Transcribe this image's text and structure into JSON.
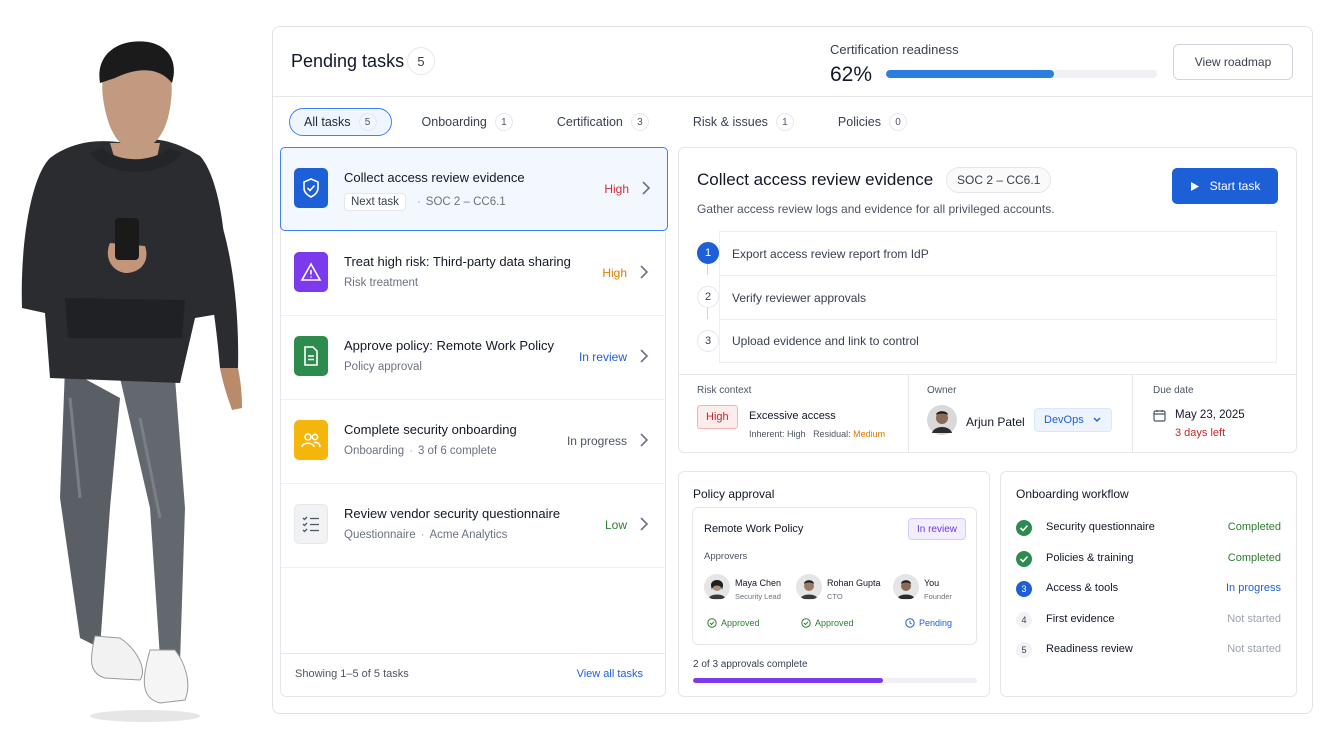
{
  "header": {
    "title": "Pending tasks",
    "count": "5",
    "readiness_label": "Certification readiness",
    "readiness_pct": "62%",
    "readiness_value": 0.62,
    "roadmap_label": "View roadmap"
  },
  "tabs": [
    {
      "label": "All tasks",
      "count": "5"
    },
    {
      "label": "Onboarding",
      "count": "1"
    },
    {
      "label": "Certification",
      "count": "3"
    },
    {
      "label": "Risk & issues",
      "count": "1"
    },
    {
      "label": "Policies",
      "count": "0"
    }
  ],
  "tasks": [
    {
      "name": "Collect access review evidence",
      "chip": "Next task",
      "sub": "SOC 2 – CC6.1",
      "status": "High",
      "icon": "shield-icon"
    },
    {
      "name": "Treat high risk: Third-party data sharing",
      "sub": "Risk treatment",
      "status": "High",
      "icon": "warning-icon"
    },
    {
      "name": "Approve policy: Remote Work Policy",
      "sub": "Policy approval",
      "status": "In review",
      "icon": "document-icon"
    },
    {
      "name": "Complete security onboarding",
      "sub": "Onboarding",
      "sub2": "3 of 6 complete",
      "status": "In progress",
      "icon": "users-icon"
    },
    {
      "name": "Review vendor security questionnaire",
      "sub": "Questionnaire",
      "sub2": "Acme Analytics",
      "status": "Low",
      "icon": "checklist-icon"
    }
  ],
  "list_footer": {
    "showing": "Showing 1–5 of 5 tasks",
    "view_all": "View all tasks"
  },
  "detail": {
    "title": "Collect access review evidence",
    "chip": "SOC 2 – CC6.1",
    "description": "Gather access review logs and evidence for all privileged accounts.",
    "start_label": "Start task",
    "steps": [
      {
        "num": "1",
        "label": "Export access review report from IdP"
      },
      {
        "num": "2",
        "label": "Verify reviewer approvals"
      },
      {
        "num": "3",
        "label": "Upload evidence and link to control"
      }
    ],
    "risk_label": "Risk context",
    "risk_badge": "High",
    "risk_title": "Excessive access",
    "risk_inherent": "Inherent: High",
    "risk_residual_label": "Residual:",
    "risk_residual": "Medium",
    "owner_label": "Owner",
    "owner_name": "Arjun Patel",
    "owner_team": "DevOps",
    "due_label": "Due date",
    "due_date": "May 23, 2025",
    "due_left": "3 days left"
  },
  "policy": {
    "title": "Policy approval",
    "name": "Remote Work Policy",
    "badge": "In review",
    "approvers_label": "Approvers",
    "approvers": [
      {
        "name": "Maya Chen",
        "role": "Security Lead",
        "status": "Approved"
      },
      {
        "name": "Rohan Gupta",
        "role": "CTO",
        "status": "Approved"
      },
      {
        "name": "You",
        "role": "Founder",
        "status": "Pending"
      }
    ],
    "progress_text": "2 of 3 approvals complete",
    "progress_value": 0.67
  },
  "onboarding": {
    "title": "Onboarding workflow",
    "items": [
      {
        "label": "Security questionnaire",
        "status": "Completed",
        "num": ""
      },
      {
        "label": "Policies & training",
        "status": "Completed",
        "num": ""
      },
      {
        "label": "Access & tools",
        "status": "In progress",
        "num": "3"
      },
      {
        "label": "First evidence",
        "status": "Not started",
        "num": "4"
      },
      {
        "label": "Readiness review",
        "status": "Not started",
        "num": "5"
      }
    ]
  },
  "colors": {
    "accent": "#1d5fd6",
    "high": "#d32f2f",
    "high_orange": "#e07b00",
    "low": "#2e7d32",
    "completed": "#2e7d32",
    "purple": "#7c3aed"
  }
}
